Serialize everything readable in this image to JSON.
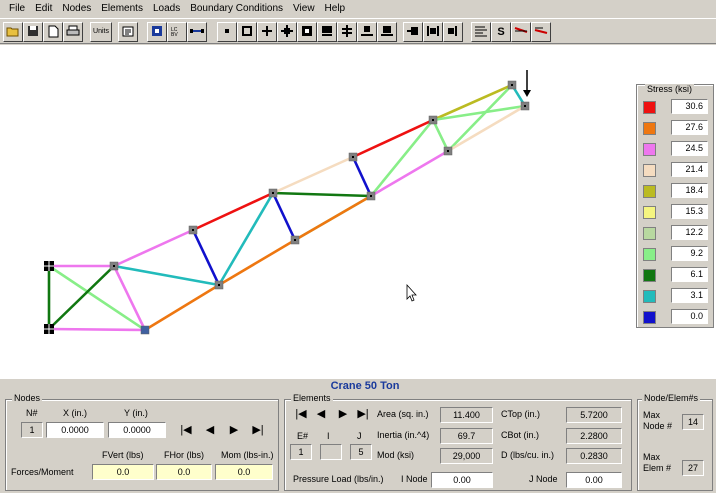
{
  "menu": [
    "File",
    "Edit",
    "Nodes",
    "Elements",
    "Loads",
    "Boundary Conditions",
    "View",
    "Help"
  ],
  "toolbar": {
    "buttons": [
      {
        "name": "open-icon"
      },
      {
        "name": "save-icon"
      },
      {
        "name": "new-icon"
      },
      {
        "name": "print-icon"
      },
      {
        "name": "units-button",
        "label": "Units"
      },
      {
        "name": "properties-icon"
      },
      {
        "name": "node-mode-icon"
      },
      {
        "name": "element-mode-icon"
      },
      {
        "name": "line-icon"
      },
      {
        "name": "support-free-icon"
      },
      {
        "name": "support-pin-icon"
      },
      {
        "name": "support-roller-x-icon"
      },
      {
        "name": "support-roller-y-icon"
      },
      {
        "name": "support-fixed-icon"
      },
      {
        "name": "support-guided-icon"
      },
      {
        "name": "support-slider-icon"
      },
      {
        "name": "support-clamp-icon"
      },
      {
        "name": "support-rotational-icon"
      },
      {
        "name": "support-hinge-icon"
      },
      {
        "name": "support-end-icon"
      },
      {
        "name": "solve-icon"
      },
      {
        "name": "stress-button",
        "label": "S"
      },
      {
        "name": "deformed-icon"
      },
      {
        "name": "animate-icon"
      }
    ]
  },
  "legend": {
    "title": "Stress (ksi)",
    "items": [
      {
        "color": "#ee1111",
        "value": "30.6"
      },
      {
        "color": "#ee7711",
        "value": "27.6"
      },
      {
        "color": "#ee77ee",
        "value": "24.5"
      },
      {
        "color": "#f5dcc0",
        "value": "21.4"
      },
      {
        "color": "#bbbb22",
        "value": "18.4"
      },
      {
        "color": "#f5f580",
        "value": "15.3"
      },
      {
        "color": "#b8d8a0",
        "value": "12.2"
      },
      {
        "color": "#88ee88",
        "value": "9.2"
      },
      {
        "color": "#117711",
        "value": "6.1"
      },
      {
        "color": "#22bbbb",
        "value": "3.1"
      },
      {
        "color": "#1111cc",
        "value": "0.0"
      }
    ]
  },
  "truss": {
    "colors": {
      "node": "#808080",
      "support": "#000000",
      "load": "#000000"
    }
  },
  "bottom": {
    "title": "Crane 50 Ton",
    "nodes": {
      "group_title": "Nodes",
      "n_label": "N#",
      "x_label": "X (in.)",
      "y_label": "Y (in.)",
      "n_value": "1",
      "x_value": "0.0000",
      "y_value": "0.0000",
      "forces_label": "Forces/Moment",
      "fvert_label": "FVert (lbs)",
      "fhor_label": "FHor (lbs)",
      "mom_label": "Mom (lbs-in.)",
      "fvert_value": "0.0",
      "fhor_value": "0.0",
      "mom_value": "0.0"
    },
    "elements": {
      "group_title": "Elements",
      "e_label": "E#",
      "i_label": "I",
      "j_label": "J",
      "e_value": "1",
      "i_value": "",
      "j_value": "5",
      "area_label": "Area (sq. in.)",
      "area_value": "11.400",
      "inertia_label": "Inertia (in.^4)",
      "inertia_value": "69.7",
      "mod_label": "Mod (ksi)",
      "mod_value": "29,000",
      "ctop_label": "CTop (in.)",
      "ctop_value": "5.7200",
      "cbot_label": "CBot (in.)",
      "cbot_value": "2.2800",
      "d_label": "D (lbs/cu. in.)",
      "d_value": "0.2830",
      "pressure_label": "Pressure Load (lbs/in.)",
      "pressure_value": "0.00",
      "inode_label": "I Node",
      "jnode_label": "J Node",
      "jnode_value": "0.00"
    },
    "nodeelem": {
      "group_title": "Node/Elem#s",
      "max_node_label": "Max Node #",
      "max_node_value": "14",
      "max_elem_label": "Max Elem #",
      "max_elem_value": "27"
    }
  }
}
